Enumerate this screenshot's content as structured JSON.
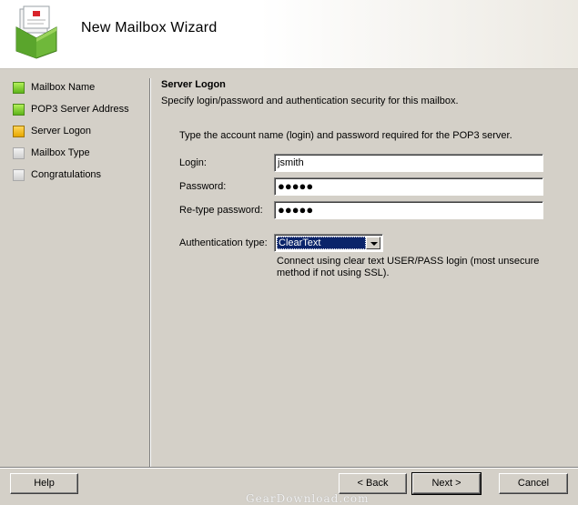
{
  "header": {
    "title": "New Mailbox Wizard",
    "icon": "mailbox-icon"
  },
  "steps": [
    {
      "label": "Mailbox Name",
      "state": "done"
    },
    {
      "label": "POP3 Server Address",
      "state": "done"
    },
    {
      "label": "Server Logon",
      "state": "current"
    },
    {
      "label": "Mailbox Type",
      "state": "pending"
    },
    {
      "label": "Congratulations",
      "state": "pending"
    }
  ],
  "section": {
    "title": "Server Logon",
    "description": "Specify login/password and authentication security for this mailbox."
  },
  "form": {
    "intro": "Type the account name (login) and password required for the POP3 server.",
    "login": {
      "label": "Login:",
      "value": "jsmith"
    },
    "password": {
      "label": "Password:",
      "value": "●●●●●"
    },
    "retype": {
      "label": "Re-type password:",
      "value": "●●●●●"
    },
    "auth": {
      "label": "Authentication type:",
      "value": "ClearText",
      "description": "Connect using clear text USER/PASS login (most unsecure method if not using SSL)."
    }
  },
  "buttons": {
    "help": "Help",
    "back": "< Back",
    "next": "Next >",
    "cancel": "Cancel"
  },
  "watermark": "GearDownload.com",
  "colors": {
    "done": "#5db41a",
    "current": "#e7a800",
    "pending": "#cfcfcf",
    "selection": "#0a246a"
  }
}
